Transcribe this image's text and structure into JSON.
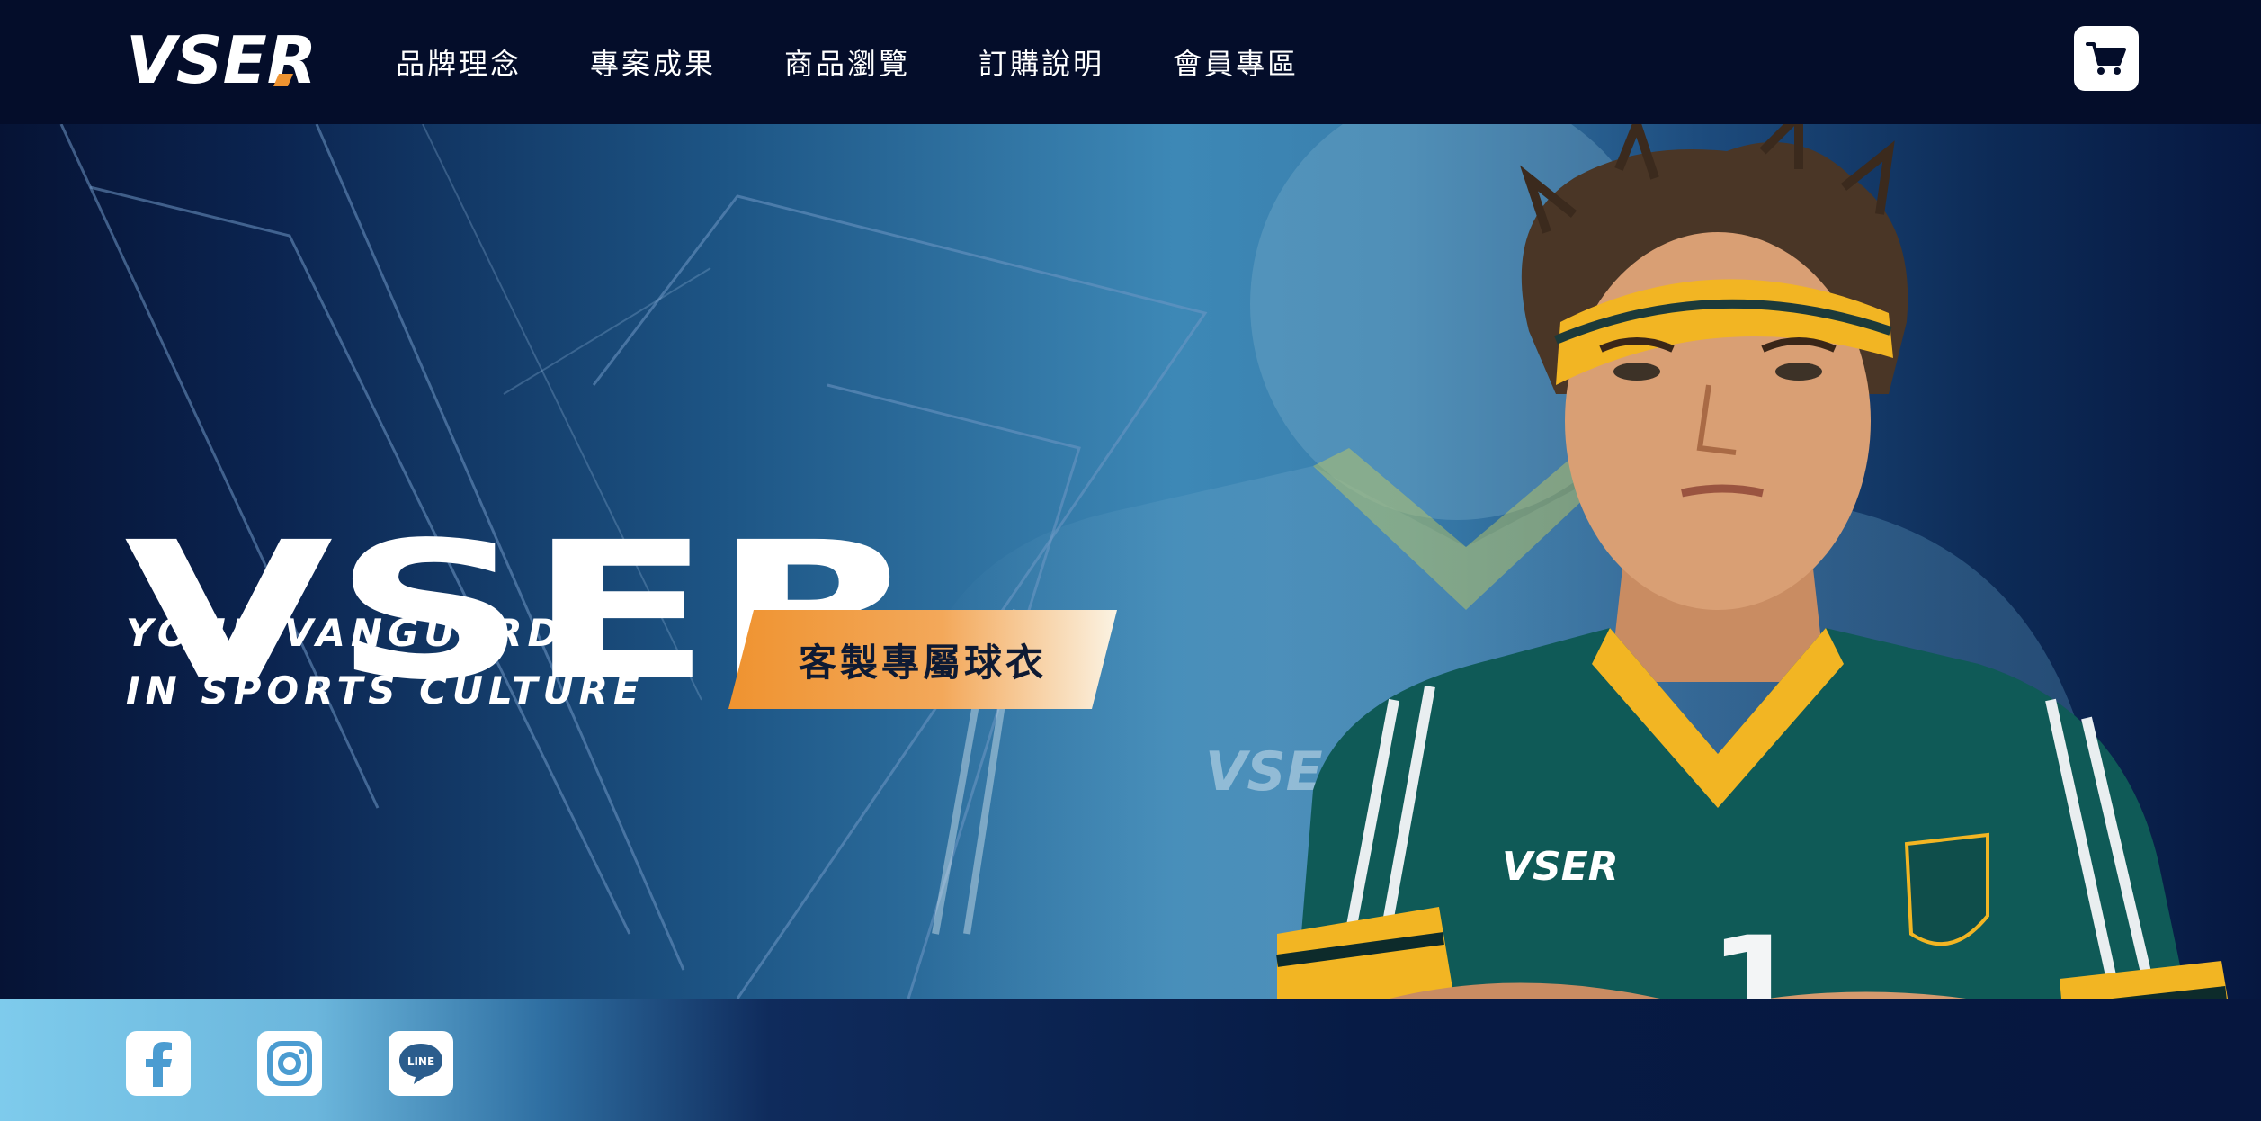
{
  "brand": {
    "logo_text": "VSER",
    "hero_title": "VSER"
  },
  "nav": {
    "items": [
      {
        "label": "品牌理念"
      },
      {
        "label": "專案成果"
      },
      {
        "label": "商品瀏覽"
      },
      {
        "label": "訂購說明"
      },
      {
        "label": "會員專區"
      }
    ]
  },
  "cart": {
    "icon": "cart-icon"
  },
  "hero": {
    "tagline_line1": "YOUR VANGUARD",
    "tagline_line2": "IN SPORTS CULTURE",
    "cta_label": "客製專屬球衣",
    "jersey_logo": "VSER",
    "jersey_number": "1",
    "badge_text": "VSER"
  },
  "social": [
    {
      "name": "facebook",
      "icon": "facebook-icon"
    },
    {
      "name": "instagram",
      "icon": "instagram-icon"
    },
    {
      "name": "line",
      "icon": "line-icon",
      "label": "LINE"
    }
  ],
  "colors": {
    "header_bg": "#040d2a",
    "accent_orange": "#ef9330",
    "jersey_green": "#0f5a57",
    "jersey_yellow": "#f2b523",
    "hero_blue": "#3d88b6"
  }
}
